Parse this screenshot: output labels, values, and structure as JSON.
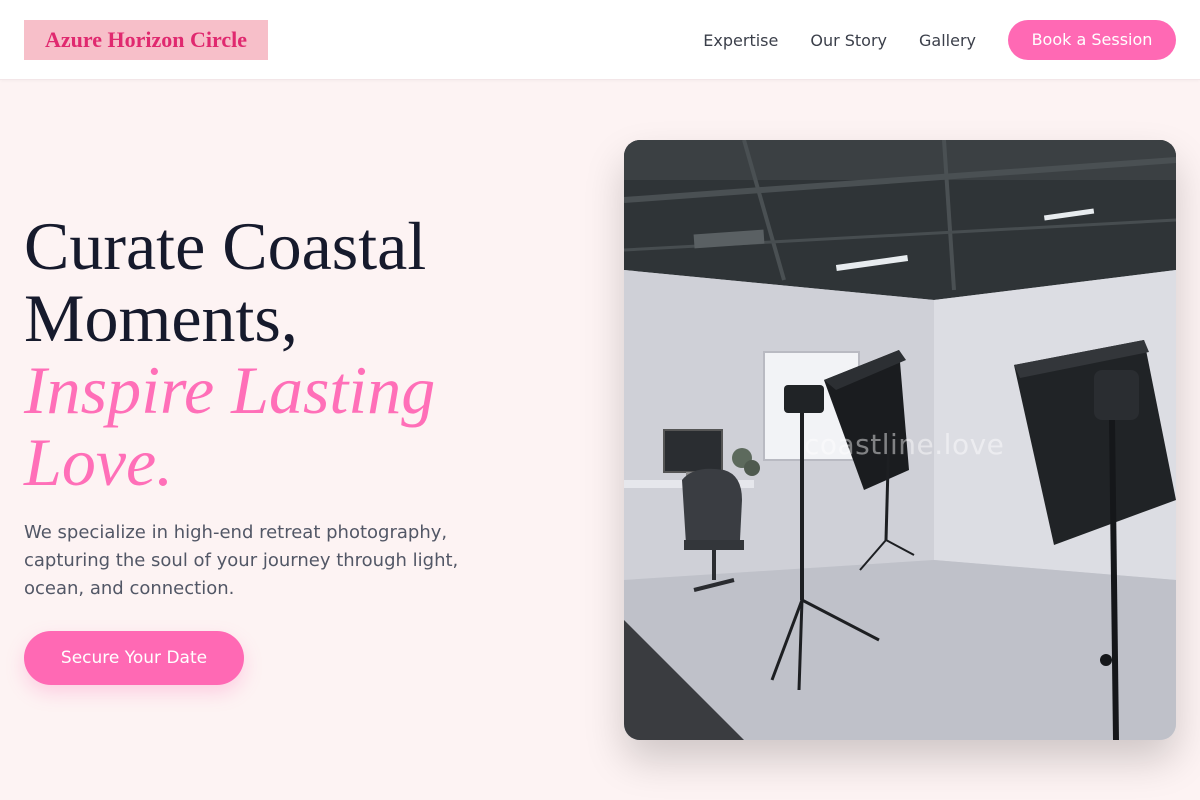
{
  "brand": {
    "name": "Azure Horizon Circle"
  },
  "nav": {
    "items": [
      "Expertise",
      "Our Story",
      "Gallery"
    ],
    "cta_label": "Book a Session"
  },
  "hero": {
    "title_line1": "Curate Coastal",
    "title_line2": "Moments,",
    "accent_line1": "Inspire Lasting",
    "accent_line2": "Love.",
    "description": "We specialize in high-end retreat photography, capturing the soul of your journey through light, ocean, and connection.",
    "cta_label": "Secure Your Date"
  },
  "image": {
    "subject": "photography studio with softbox lights",
    "watermark": "coastline.love"
  },
  "colors": {
    "accent": "#ff69b4",
    "brand_text": "#e0296f",
    "brand_bg": "#f7bfc9",
    "page_bg": "#fdf3f3",
    "heading": "#161a2c"
  }
}
